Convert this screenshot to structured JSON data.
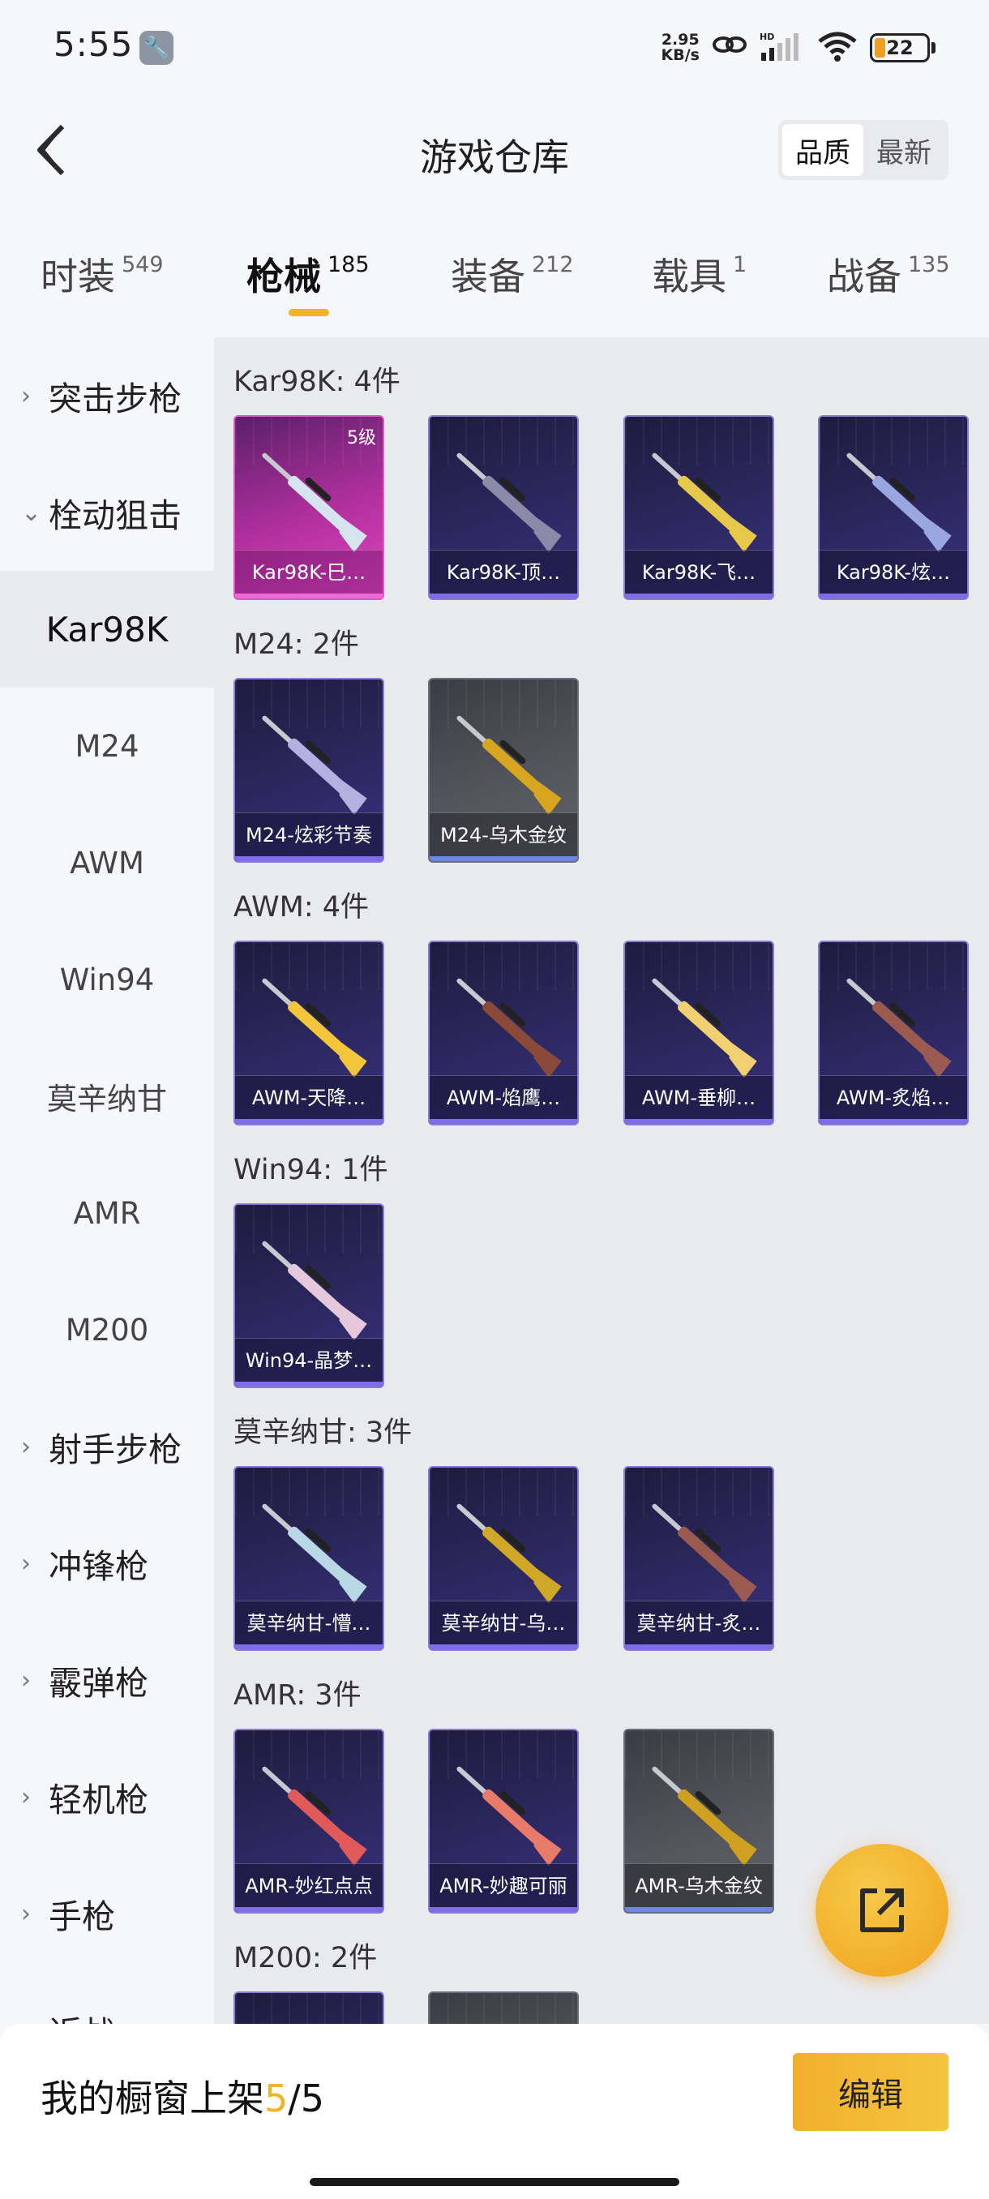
{
  "status": {
    "time": "5:55",
    "net_speed_top": "2.95",
    "net_speed_bottom": "KB/s",
    "battery": "22"
  },
  "header": {
    "title": "游戏仓库",
    "sort_quality": "品质",
    "sort_latest": "最新"
  },
  "tabs": [
    {
      "label": "时装",
      "count": "549"
    },
    {
      "label": "枪械",
      "count": "185"
    },
    {
      "label": "装备",
      "count": "212"
    },
    {
      "label": "载具",
      "count": "1"
    },
    {
      "label": "战备",
      "count": "135"
    }
  ],
  "sidebar": {
    "items": [
      {
        "label": "突击步枪",
        "chevron": "›"
      },
      {
        "label": "栓动狙击",
        "chevron": "⌄"
      },
      {
        "label": "Kar98K"
      },
      {
        "label": "M24"
      },
      {
        "label": "AWM"
      },
      {
        "label": "Win94"
      },
      {
        "label": "莫辛纳甘"
      },
      {
        "label": "AMR"
      },
      {
        "label": "M200"
      },
      {
        "label": "射手步枪",
        "chevron": "›"
      },
      {
        "label": "冲锋枪",
        "chevron": "›"
      },
      {
        "label": "霰弹枪",
        "chevron": "›"
      },
      {
        "label": "轻机枪",
        "chevron": "›"
      },
      {
        "label": "手枪",
        "chevron": "›"
      },
      {
        "label": "近战",
        "chevron": "›"
      }
    ]
  },
  "sections": [
    {
      "title": "Kar98K: 4件",
      "cards": [
        {
          "name": "Kar98K-巳…",
          "level": "5级",
          "color": "#d6e4f0"
        },
        {
          "name": "Kar98K-顶…",
          "color": "#8c8aa8"
        },
        {
          "name": "Kar98K-飞…",
          "color": "#e6c84a"
        },
        {
          "name": "Kar98K-炫…",
          "color": "#9aa6e0"
        }
      ]
    },
    {
      "title": "M24: 2件",
      "cards": [
        {
          "name": "M24-炫彩节奏",
          "color": "#b4b0e0"
        },
        {
          "name": "M24-乌木金纹",
          "color": "#d8a520"
        }
      ]
    },
    {
      "title": "AWM: 4件",
      "cards": [
        {
          "name": "AWM-天降…",
          "color": "#f2c53a"
        },
        {
          "name": "AWM-焰鹰…",
          "color": "#8a4a3a"
        },
        {
          "name": "AWM-垂柳…",
          "color": "#f0d070"
        },
        {
          "name": "AWM-炙焰…",
          "color": "#9a5a50"
        }
      ]
    },
    {
      "title": "Win94: 1件",
      "cards": [
        {
          "name": "Win94-晶梦…",
          "color": "#e6c8dc"
        }
      ]
    },
    {
      "title": "莫辛纳甘: 3件",
      "cards": [
        {
          "name": "莫辛纳甘-懵…",
          "color": "#b8d8e6"
        },
        {
          "name": "莫辛纳甘-乌…",
          "color": "#d0a828"
        },
        {
          "name": "莫辛纳甘-炙…",
          "color": "#9a5a50"
        }
      ]
    },
    {
      "title": "AMR: 3件",
      "cards": [
        {
          "name": "AMR-妙红点点",
          "color": "#e05a5a"
        },
        {
          "name": "AMR-妙趣可丽",
          "color": "#e87a6a"
        },
        {
          "name": "AMR-乌木金纹",
          "color": "#d0a020"
        }
      ]
    },
    {
      "title": "M200: 2件",
      "cards": [
        {
          "name": "",
          "color": "#f0b020"
        },
        {
          "name": "",
          "color": "#d0a020"
        }
      ]
    }
  ],
  "showcase": {
    "prefix": "我的橱窗上架 ",
    "current": "5",
    "separator": "/",
    "total": "5",
    "edit_label": "编辑"
  },
  "colors": {
    "accent": "#f0b428",
    "rare": "#8b79d6",
    "legendary": "#e255c8",
    "common": "#6a6e7a"
  }
}
